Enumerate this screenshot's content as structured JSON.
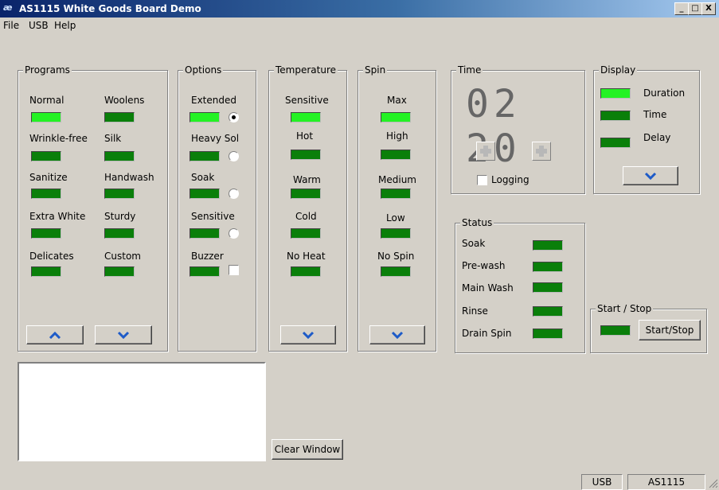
{
  "window": {
    "title": "AS1115 White Goods Board Demo",
    "icon": "app-icon",
    "btn_min": "_",
    "btn_max": "□",
    "btn_close": "X"
  },
  "menu": [
    "File",
    "USB",
    "Help"
  ],
  "programs": {
    "title": "Programs",
    "items": [
      {
        "label": "Normal",
        "on": true
      },
      {
        "label": "Woolens",
        "on": false
      },
      {
        "label": "Wrinkle-free",
        "on": false
      },
      {
        "label": "Silk",
        "on": false
      },
      {
        "label": "Sanitize",
        "on": false
      },
      {
        "label": "Handwash",
        "on": false
      },
      {
        "label": "Extra White",
        "on": false
      },
      {
        "label": "Sturdy",
        "on": false
      },
      {
        "label": "Delicates",
        "on": false
      },
      {
        "label": "Custom",
        "on": false
      }
    ],
    "up_icon": "chevron-up-icon",
    "down_icon": "chevron-down-icon"
  },
  "options": {
    "title": "Options",
    "items": [
      {
        "label": "Extended",
        "on": true,
        "control": "radio",
        "checked": true
      },
      {
        "label": "Heavy Sol",
        "on": false,
        "control": "radio",
        "checked": false
      },
      {
        "label": "Soak",
        "on": false,
        "control": "radio",
        "checked": false
      },
      {
        "label": "Sensitive",
        "on": false,
        "control": "radio",
        "checked": false
      },
      {
        "label": "Buzzer",
        "on": false,
        "control": "checkbox",
        "checked": false
      }
    ]
  },
  "temperature": {
    "title": "Temperature",
    "items": [
      {
        "label": "Sensitive",
        "on": true
      },
      {
        "label": "Hot",
        "on": false
      },
      {
        "label": "Warm",
        "on": false
      },
      {
        "label": "Cold",
        "on": false
      },
      {
        "label": "No Heat",
        "on": false
      }
    ]
  },
  "spin": {
    "title": "Spin",
    "items": [
      {
        "label": "Max",
        "on": true
      },
      {
        "label": "High",
        "on": false
      },
      {
        "label": "Medium",
        "on": false
      },
      {
        "label": "Low",
        "on": false
      },
      {
        "label": "No Spin",
        "on": false
      }
    ]
  },
  "time": {
    "title": "Time",
    "display": "02 20",
    "logging_label": "Logging",
    "logging_checked": false,
    "plus_icon": "plus-icon"
  },
  "display": {
    "title": "Display",
    "items": [
      {
        "label": "Duration",
        "on": true
      },
      {
        "label": "Time",
        "on": false
      },
      {
        "label": "Delay",
        "on": false
      }
    ]
  },
  "status": {
    "title": "Status",
    "items": [
      {
        "label": "Soak",
        "on": false
      },
      {
        "label": "Pre-wash",
        "on": false
      },
      {
        "label": "Main Wash",
        "on": false
      },
      {
        "label": "Rinse",
        "on": false
      },
      {
        "label": "Drain Spin",
        "on": false
      }
    ]
  },
  "start_stop": {
    "title": "Start / Stop",
    "button_label": "Start/Stop",
    "led_on": false
  },
  "clear_button_label": "Clear Window",
  "log_text": "",
  "statusbar": [
    "USB",
    "AS1115"
  ],
  "colors": {
    "led_on": "#24f224",
    "led_off": "#0a7f0a",
    "chevron": "#1e5bc8",
    "titlebar": "#0a246a"
  }
}
